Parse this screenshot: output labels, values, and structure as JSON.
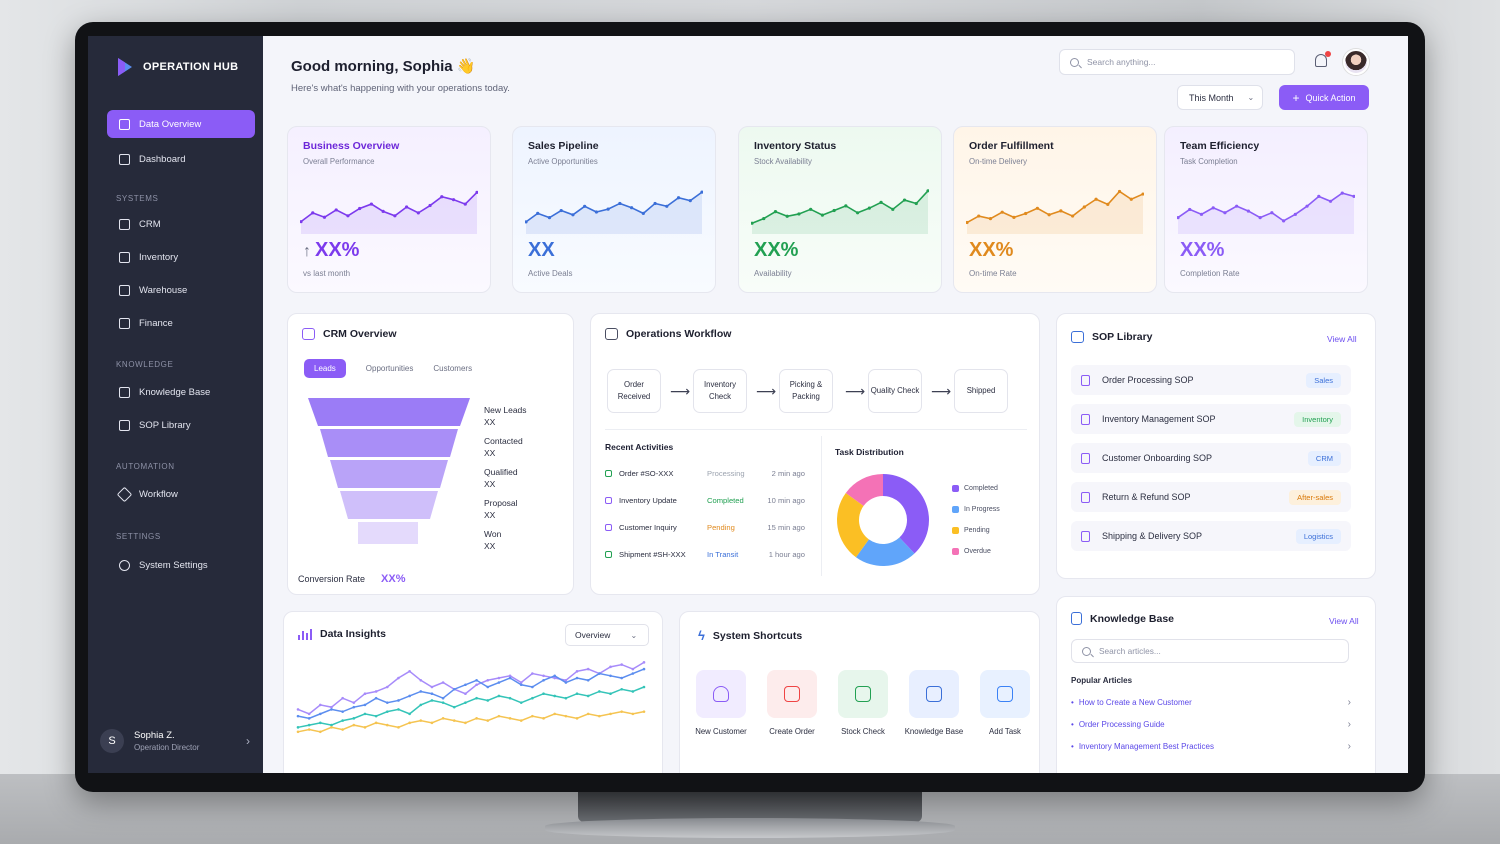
{
  "app": {
    "name": "OPERATION HUB"
  },
  "sidebar": {
    "items": [
      {
        "label": "Data Overview",
        "active": true
      },
      {
        "label": "Dashboard"
      }
    ],
    "sections": [
      {
        "title": "SYSTEMS",
        "items": [
          "CRM",
          "Inventory",
          "Warehouse",
          "Finance"
        ]
      },
      {
        "title": "KNOWLEDGE",
        "items": [
          "Knowledge Base",
          "SOP Library"
        ]
      },
      {
        "title": "AUTOMATION",
        "items": [
          "Workflow"
        ]
      },
      {
        "title": "SETTINGS",
        "items": [
          "System Settings"
        ]
      }
    ],
    "user": {
      "initial": "S",
      "name": "Sophia Z.",
      "role": "Operation Director"
    }
  },
  "header": {
    "greeting": "Good morning, Sophia 👋",
    "subtitle": "Here's what's happening with your operations today.",
    "search_placeholder": "Search anything...",
    "period": "This Month",
    "quick_action": "Quick Action"
  },
  "kpis": [
    {
      "title": "Business Overview",
      "subtitle": "Overall Performance",
      "value": "XX%",
      "caption": "vs last month",
      "color": "#7c3aed",
      "trend": [
        40,
        46,
        43,
        48,
        44,
        49,
        52,
        47,
        44,
        50,
        46,
        51,
        57,
        55,
        52,
        60
      ]
    },
    {
      "title": "Sales Pipeline",
      "subtitle": "Active Opportunities",
      "value": "XX",
      "caption": "Active Deals",
      "color": "#3b6fd8",
      "trend": [
        42,
        48,
        45,
        50,
        47,
        53,
        49,
        51,
        55,
        52,
        48,
        55,
        53,
        59,
        57,
        63
      ]
    },
    {
      "title": "Inventory Status",
      "subtitle": "Stock Availability",
      "value": "XX%",
      "caption": "Availability",
      "color": "#22a052",
      "trend": [
        38,
        42,
        48,
        44,
        46,
        50,
        45,
        49,
        53,
        47,
        51,
        56,
        50,
        58,
        55,
        66
      ]
    },
    {
      "title": "Order Fulfillment",
      "subtitle": "On-time Delivery",
      "value": "XX%",
      "caption": "On-time Rate",
      "color": "#e08a1e",
      "trend": [
        40,
        45,
        43,
        48,
        44,
        47,
        51,
        46,
        49,
        45,
        52,
        58,
        54,
        64,
        58,
        62
      ]
    },
    {
      "title": "Team Efficiency",
      "subtitle": "Task Completion",
      "value": "XX%",
      "caption": "Completion Rate",
      "color": "#8b5cf6",
      "trend": [
        45,
        50,
        47,
        51,
        48,
        52,
        49,
        45,
        48,
        43,
        47,
        52,
        58,
        55,
        60,
        58
      ]
    }
  ],
  "crm": {
    "title": "CRM Overview",
    "tabs": [
      "Leads",
      "Opportunities",
      "Customers"
    ],
    "funnel": [
      {
        "label": "New Leads",
        "value": "XX"
      },
      {
        "label": "Contacted",
        "value": "XX"
      },
      {
        "label": "Qualified",
        "value": "XX"
      },
      {
        "label": "Proposal",
        "value": "XX"
      },
      {
        "label": "Won",
        "value": "XX"
      }
    ],
    "conversion_label": "Conversion Rate",
    "conversion_value": "XX%"
  },
  "workflow": {
    "title": "Operations Workflow",
    "steps": [
      "Order Received",
      "Inventory Check",
      "Picking & Packing",
      "Quality Check",
      "Shipped"
    ],
    "recent_title": "Recent Activities",
    "activities": [
      {
        "name": "Order #SO-XXX",
        "status": "Processing",
        "time": "2 min ago",
        "color": "#9ca3af"
      },
      {
        "name": "Inventory Update",
        "status": "Completed",
        "time": "10 min ago",
        "color": "#22a052"
      },
      {
        "name": "Customer Inquiry",
        "status": "Pending",
        "time": "15 min ago",
        "color": "#e08a1e"
      },
      {
        "name": "Shipment #SH-XXX",
        "status": "In Transit",
        "time": "1 hour ago",
        "color": "#3b6fd8"
      }
    ],
    "task_title": "Task Distribution",
    "task_legend": [
      {
        "label": "Completed",
        "color": "#8b5cf6"
      },
      {
        "label": "In Progress",
        "color": "#60a5fa"
      },
      {
        "label": "Pending",
        "color": "#fbbf24"
      },
      {
        "label": "Overdue",
        "color": "#f472b6"
      }
    ]
  },
  "chart_data": {
    "type": "pie",
    "title": "Task Distribution",
    "categories": [
      "Completed",
      "In Progress",
      "Pending",
      "Overdue"
    ],
    "values": [
      38,
      22,
      25,
      15
    ]
  },
  "sop": {
    "title": "SOP Library",
    "view_all": "View All",
    "items": [
      {
        "label": "Order Processing SOP",
        "tag": "Sales",
        "tag_color": "#3b6fd8",
        "tag_bg": "#e6efff"
      },
      {
        "label": "Inventory Management SOP",
        "tag": "Inventory",
        "tag_color": "#22a052",
        "tag_bg": "#e4f6ea"
      },
      {
        "label": "Customer Onboarding SOP",
        "tag": "CRM",
        "tag_color": "#3b6fd8",
        "tag_bg": "#e6efff"
      },
      {
        "label": "Return & Refund SOP",
        "tag": "After-sales",
        "tag_color": "#d97706",
        "tag_bg": "#fdf0dc"
      },
      {
        "label": "Shipping & Delivery SOP",
        "tag": "Logistics",
        "tag_color": "#3b6fd8",
        "tag_bg": "#e6efff"
      }
    ]
  },
  "insights": {
    "title": "Data Insights",
    "dropdown": "Overview",
    "series": [
      {
        "color": "#a78bfa",
        "values": [
          30,
          26,
          34,
          32,
          40,
          36,
          44,
          46,
          50,
          58,
          64,
          56,
          50,
          54,
          48,
          44,
          52,
          56,
          58,
          60,
          54,
          62,
          60,
          58,
          56,
          64,
          66,
          62,
          68,
          70,
          66,
          72
        ]
      },
      {
        "color": "#5b8def",
        "values": [
          24,
          22,
          26,
          30,
          28,
          32,
          34,
          40,
          36,
          38,
          42,
          46,
          44,
          40,
          48,
          52,
          56,
          50,
          54,
          58,
          52,
          50,
          56,
          60,
          54,
          58,
          56,
          62,
          60,
          58,
          62,
          66
        ]
      },
      {
        "color": "#34c4b8",
        "values": [
          14,
          16,
          18,
          16,
          20,
          22,
          26,
          24,
          28,
          30,
          26,
          34,
          38,
          36,
          32,
          36,
          40,
          38,
          42,
          40,
          36,
          40,
          44,
          42,
          40,
          44,
          42,
          46,
          44,
          48,
          46,
          50
        ]
      },
      {
        "color": "#f5c451",
        "values": [
          10,
          12,
          10,
          14,
          12,
          16,
          14,
          18,
          16,
          14,
          18,
          20,
          18,
          22,
          20,
          18,
          22,
          20,
          24,
          22,
          20,
          24,
          22,
          26,
          24,
          22,
          26,
          24,
          26,
          28,
          26,
          28
        ]
      }
    ]
  },
  "shortcuts": {
    "title": "System Shortcuts",
    "items": [
      {
        "label": "New Customer",
        "color": "#8b5cf6",
        "bg": "#f1ecff",
        "icon": "user-icon"
      },
      {
        "label": "Create Order",
        "color": "#ef4444",
        "bg": "#fdecec",
        "icon": "clipboard-icon"
      },
      {
        "label": "Stock Check",
        "color": "#22a052",
        "bg": "#e7f6ec",
        "icon": "warehouse-icon"
      },
      {
        "label": "Knowledge Base",
        "color": "#3b6fd8",
        "bg": "#e8efff",
        "icon": "copy-icon"
      },
      {
        "label": "Add Task",
        "color": "#3b82f6",
        "bg": "#e8f1ff",
        "icon": "check-square-icon"
      }
    ]
  },
  "kb": {
    "title": "Knowledge Base",
    "view_all": "View All",
    "search_placeholder": "Search articles...",
    "popular_title": "Popular Articles",
    "articles": [
      "How to Create a New Customer",
      "Order Processing Guide",
      "Inventory Management Best Practices"
    ]
  }
}
